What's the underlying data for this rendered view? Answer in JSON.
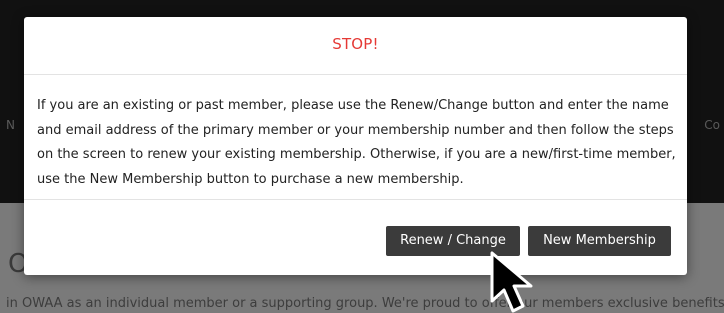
{
  "background": {
    "nav_left": "N",
    "nav_right": "Co",
    "heading_fragment": "O",
    "body_text": "in OWAA as an individual member or a supporting group. We're proud to offer our members exclusive benefits to"
  },
  "modal": {
    "title": "STOP!",
    "message": "If you are an existing or past member, please use the Renew/Change button and enter the name and email address of the primary member or your membership number and then follow the steps on the screen to renew your existing membership. Otherwise, if you are a new/first-time member, use the New Membership button to purchase a new membership.",
    "buttons": {
      "renew_label": "Renew / Change",
      "new_label": "New Membership"
    }
  },
  "colors": {
    "title": "#e53935",
    "button_bg": "#3b3b3b",
    "button_text": "#ffffff"
  },
  "icons": {
    "cursor": "mouse-pointer-icon"
  }
}
